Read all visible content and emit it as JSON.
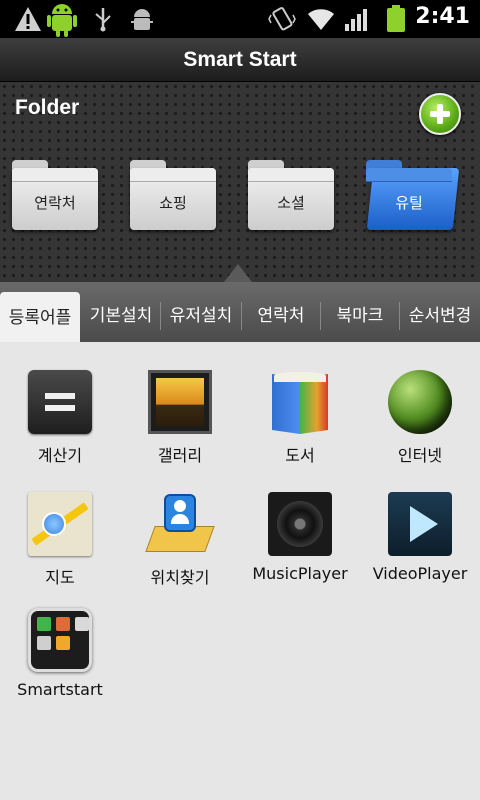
{
  "status_bar": {
    "time": "2:41",
    "icons": [
      "warning-icon",
      "android-icon",
      "usb-icon",
      "android-debug-icon",
      "vibrate-icon",
      "wifi-icon",
      "signal-icon",
      "battery-icon"
    ]
  },
  "app_title": "Smart Start",
  "folder_section": {
    "title": "Folder",
    "folders": [
      {
        "label": "연락처"
      },
      {
        "label": "쇼핑"
      },
      {
        "label": "소셜"
      },
      {
        "label": "유틸",
        "active": true
      }
    ]
  },
  "tabs": [
    {
      "label": "등록어플",
      "selected": true
    },
    {
      "label": "기본설치"
    },
    {
      "label": "유저설치"
    },
    {
      "label": "연락처"
    },
    {
      "label": "북마크"
    },
    {
      "label": "순서변경"
    }
  ],
  "apps": [
    {
      "name": "계산기",
      "icon": "calculator-icon"
    },
    {
      "name": "갤러리",
      "icon": "gallery-icon"
    },
    {
      "name": "도서",
      "icon": "books-icon"
    },
    {
      "name": "인터넷",
      "icon": "globe-icon"
    },
    {
      "name": "지도",
      "icon": "maps-icon"
    },
    {
      "name": "위치찾기",
      "icon": "places-icon"
    },
    {
      "name": "MusicPlayer",
      "icon": "music-player-icon"
    },
    {
      "name": "VideoPlayer",
      "icon": "video-player-icon"
    },
    {
      "name": "Smartstart",
      "icon": "smartstart-icon"
    }
  ],
  "colors": {
    "accent_green": "#5aa915",
    "active_folder_blue": "#3f7fd8",
    "battery_green": "#8fd12c"
  }
}
